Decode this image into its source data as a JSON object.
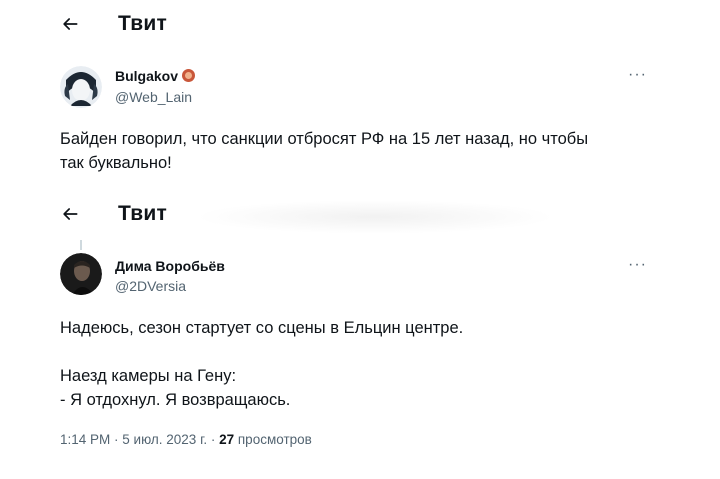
{
  "tweet1": {
    "header_title": "Твит",
    "author_name": "Bulgakov",
    "author_handle": "@Web_Lain",
    "more_label": "···",
    "text_line1": "Байден говорил, что санкции отбросят РФ на 15 лет назад, но чтобы",
    "text_line2": "так буквально!"
  },
  "tweet2": {
    "header_title": "Твит",
    "author_name": "Дима Воробьёв",
    "author_handle": "@2DVersia",
    "more_label": "···",
    "text_line1": "Надеюсь, сезон стартует со сцены в Ельцин центре.",
    "text_line2": "Наезд камеры на Гену:",
    "text_line3": "- Я отдохнул. Я возвращаюсь.",
    "meta_time": "1:14 PM · 5 июл. 2023 г. · ",
    "meta_views_count": "27",
    "meta_views_label": " просмотров"
  }
}
